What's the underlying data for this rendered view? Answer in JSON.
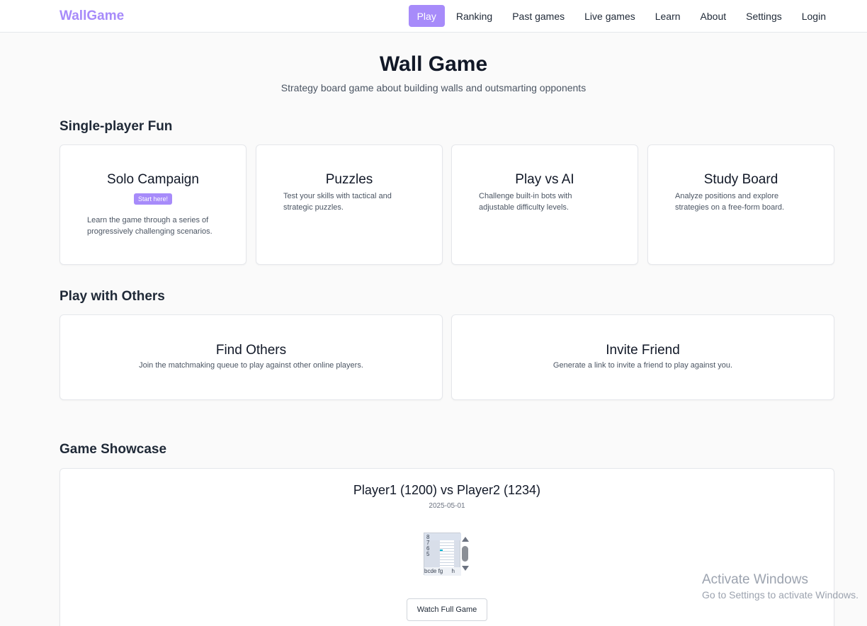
{
  "nav": {
    "brand": "WallGame",
    "links": [
      "Play",
      "Ranking",
      "Past games",
      "Live games",
      "Learn",
      "About",
      "Settings",
      "Login"
    ]
  },
  "hero": {
    "title": "Wall Game",
    "subtitle": "Strategy board game about building walls and outsmarting opponents"
  },
  "single_player": {
    "title": "Single-player Fun",
    "cards": [
      {
        "title": "Solo Campaign",
        "badge": "Start here!",
        "desc": "Learn the game through a series of progressively challenging scenarios."
      },
      {
        "title": "Puzzles",
        "desc": "Test your skills with tactical and strategic puzzles."
      },
      {
        "title": "Play vs AI",
        "desc": "Challenge built-in bots with adjustable difficulty levels."
      },
      {
        "title": "Study Board",
        "desc": "Analyze positions and explore strategies on a free-form board."
      }
    ]
  },
  "multiplayer": {
    "title": "Play with Others",
    "cards": [
      {
        "title": "Find Others",
        "desc": "Join the matchmaking queue to play against other online players."
      },
      {
        "title": "Invite Friend",
        "desc": "Generate a link to invite a friend to play against you."
      }
    ]
  },
  "showcase": {
    "title": "Game Showcase",
    "match": "Player1 (1200) vs Player2 (1234)",
    "date": "2025-05-01",
    "board_ranks": [
      "8",
      "7",
      "6",
      "5"
    ],
    "board_files": "bcde fg",
    "board_file_h": "h",
    "watch_label": "Watch Full Game"
  },
  "watermark": {
    "line1": "Activate Windows",
    "line2": "Go to Settings to activate Windows."
  }
}
